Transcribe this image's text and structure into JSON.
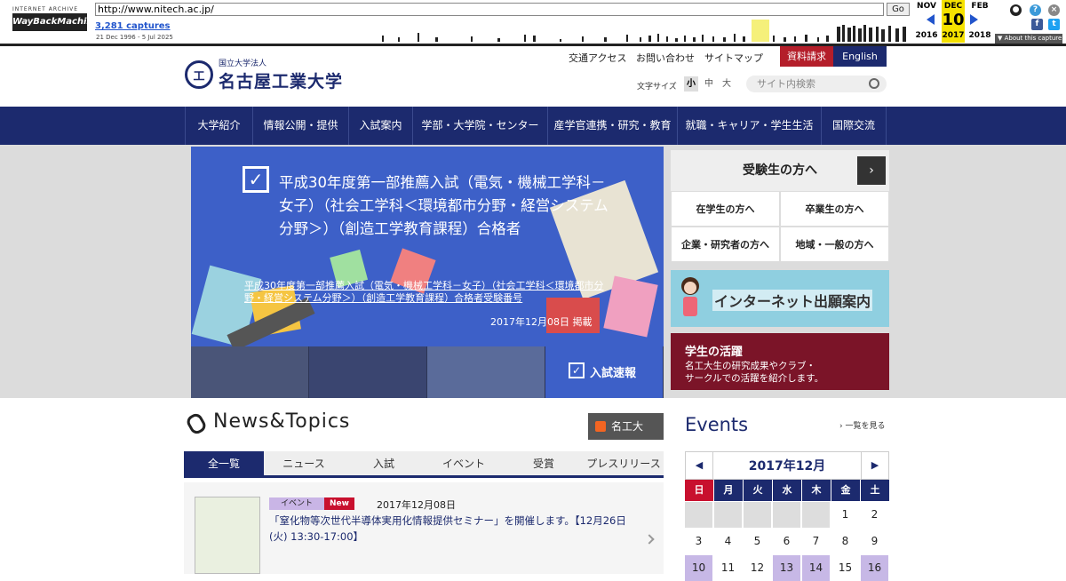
{
  "wayback": {
    "logo_top": "INTERNET ARCHIVE",
    "logo_main": "WayBackMachine",
    "url": "http://www.nitech.ac.jp/",
    "go": "Go",
    "captures": "3,281 captures",
    "range": "21 Dec 1996 - 5 Jul 2025",
    "prev_month": "NOV",
    "cur_month": "DEC",
    "next_month": "FEB",
    "day": "10",
    "prev_year": "2016",
    "cur_year": "2017",
    "next_year": "2018",
    "about": "▼ About this capture"
  },
  "header": {
    "logo_sub": "国立大学法人",
    "logo_name": "名古屋工業大学",
    "logo_mark": "工",
    "top_links": [
      "交通アクセス",
      "お問い合わせ",
      "サイトマップ"
    ],
    "request": "資料請求",
    "english": "English",
    "font_size_label": "文字サイズ",
    "font_sizes": [
      "小",
      "中",
      "大"
    ],
    "search_placeholder": "サイト内検索"
  },
  "nav": [
    "大学紹介",
    "情報公開・提供",
    "入試案内",
    "学部・大学院・センター",
    "産学官連携・研究・教育",
    "就職・キャリア・学生生活",
    "国際交流"
  ],
  "hero": {
    "title": "平成30年度第一部推薦入試（電気・機械工学科－女子）（社会工学科＜環境都市分野・経営システム分野＞）（創造工学教育課程）合格者",
    "link": "平成30年度第一部推薦入試（電気・機械工学科－女子）（社会工学科＜環境都市分野・経営システム分野＞）（創造工学教育課程）合格者受験番号",
    "date": "2017年12月08日 掲載",
    "thumb_last": "入試速報"
  },
  "side": {
    "head": "受験生の方へ",
    "cells": [
      "在学生の方へ",
      "卒業生の方へ",
      "企業・研究者の方へ",
      "地域・一般の方へ"
    ],
    "banner1": "インターネット出願案内",
    "banner2_title": "学生の活躍",
    "banner2_desc1": "名工大生の研究成果やクラブ・",
    "banner2_desc2": "サークルでの活躍を紹介します。"
  },
  "news": {
    "heading": "News&Topics",
    "rss": "名工大RSS",
    "tabs": [
      "全一覧",
      "ニュース",
      "入試",
      "イベント",
      "受賞",
      "プレスリリース"
    ],
    "item": {
      "category": "イベント",
      "new": "New",
      "date": "2017年12月08日",
      "text": "「窒化物等次世代半導体実用化情報提供セミナー」を開催します。【12月26日(火) 13:30-17:00】"
    }
  },
  "events": {
    "heading": "Events",
    "more": "一覧を見る",
    "month": "2017年12月",
    "dow": [
      "日",
      "月",
      "火",
      "水",
      "木",
      "金",
      "土"
    ],
    "row1": [
      "",
      "",
      "",
      "",
      "",
      "1",
      "2"
    ],
    "row2": [
      "3",
      "4",
      "5",
      "6",
      "7",
      "8",
      "9"
    ],
    "row3": [
      "10",
      "11",
      "12",
      "13",
      "14",
      "15",
      "16"
    ]
  },
  "colors": {
    "navy": "#1c2a6e",
    "red": "#b41e2a",
    "hero_blue": "#3d60c8",
    "event_purple": "#c7b8e6"
  }
}
